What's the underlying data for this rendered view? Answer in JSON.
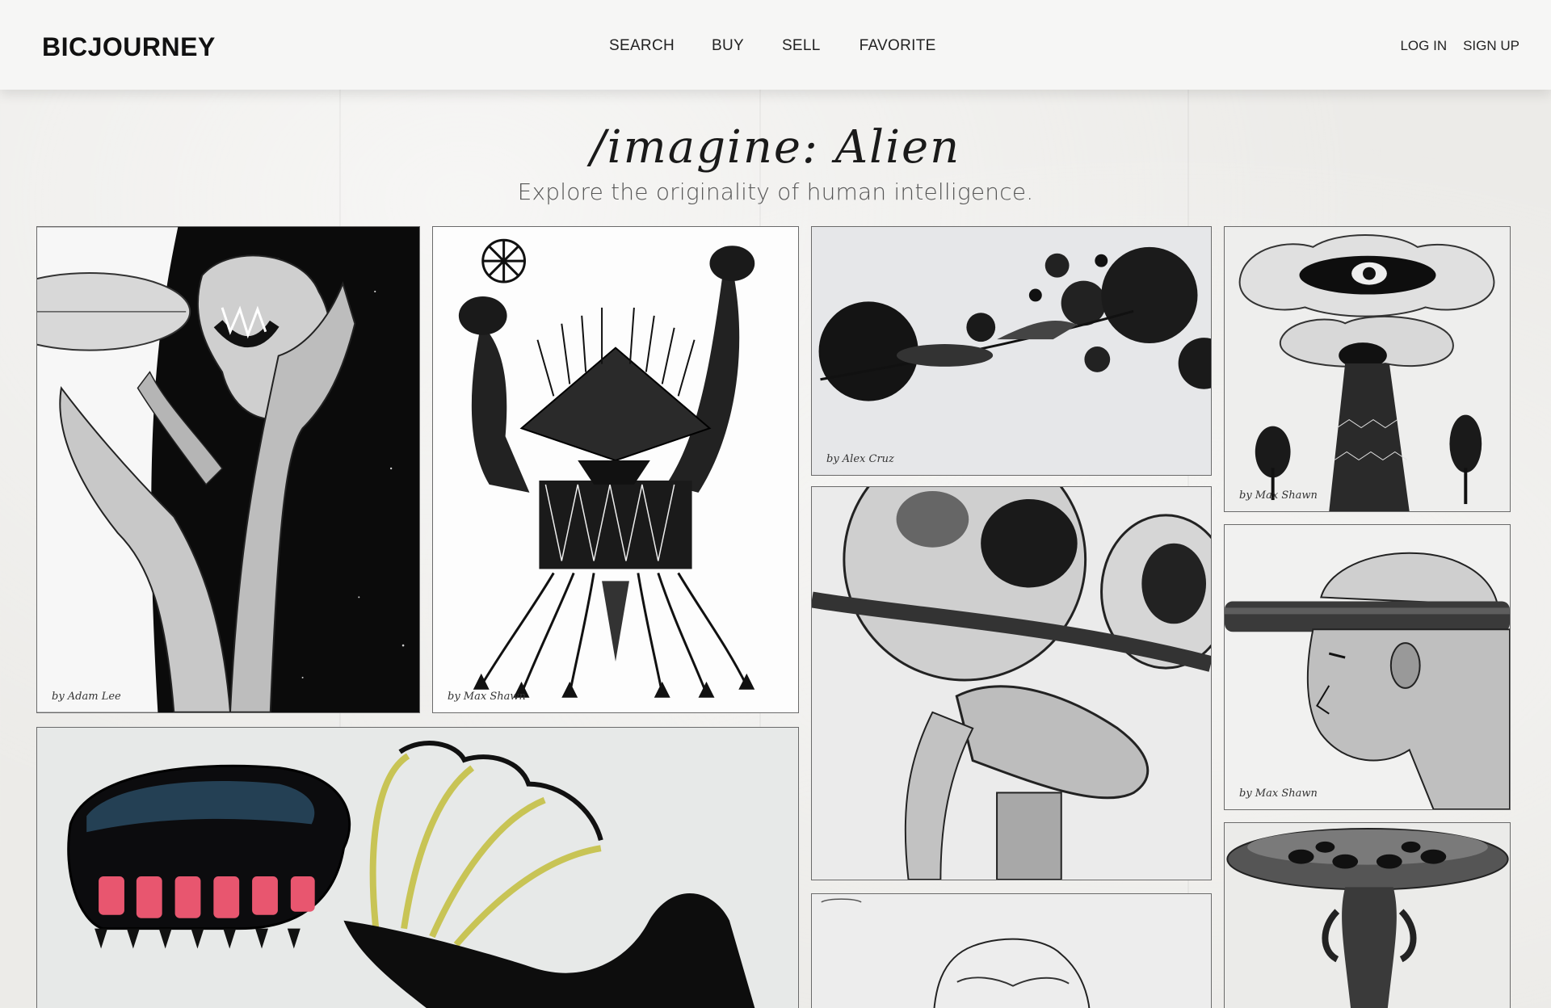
{
  "header": {
    "logo": "BICJOURNEY",
    "nav": [
      "SEARCH",
      "BUY",
      "SELL",
      "FAVORITE"
    ],
    "auth": {
      "login": "LOG IN",
      "signup": "SIGN UP"
    }
  },
  "hero": {
    "title": "/imagine: Alien",
    "subtitle": "Explore the originality of human intelligence."
  },
  "gallery": [
    {
      "alt": "alien-hands-skull",
      "signature": "by Adam Lee"
    },
    {
      "alt": "creature-with-raised-arms",
      "signature": "by Max Shawn"
    },
    {
      "alt": "planets-and-rocket",
      "signature": "by Alex Cruz"
    },
    {
      "alt": "eye-cloud-tree",
      "signature": "by Max Shawn"
    },
    {
      "alt": "tangled-sphere-creatures",
      "signature": ""
    },
    {
      "alt": "man-with-ring-hat",
      "signature": "by Max Shawn"
    },
    {
      "alt": "creature-under-saucer",
      "signature": ""
    },
    {
      "alt": "colorful-creature-with-wings",
      "signature": ""
    },
    {
      "alt": "sketch-figure",
      "signature": ""
    }
  ]
}
